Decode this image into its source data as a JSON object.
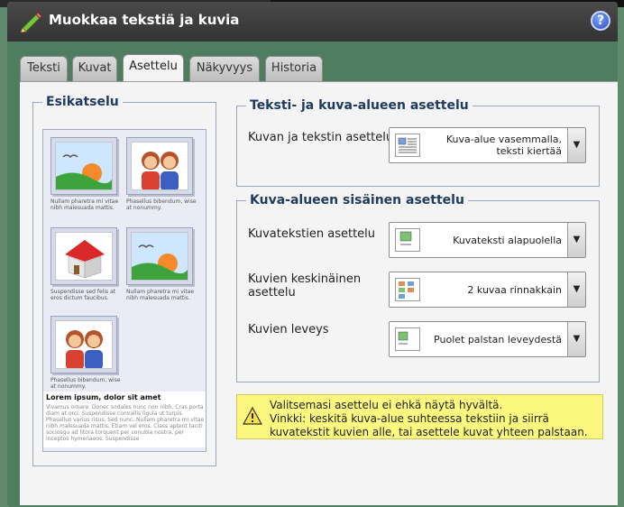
{
  "dialog": {
    "title": "Muokkaa tekstiä ja kuvia",
    "help_glyph": "?"
  },
  "tabs": [
    {
      "label": "Teksti"
    },
    {
      "label": "Kuvat"
    },
    {
      "label": "Asettelu"
    },
    {
      "label": "Näkyvyys"
    },
    {
      "label": "Historia"
    }
  ],
  "active_tab": "Asettelu",
  "preview": {
    "legend": "Esikatselu",
    "captions": [
      "Nullam pharetra mi vitae nibh malesuada mattis.",
      "Phasellus bibendum, wise at nonummy.",
      "Suspendisse sed felis at eros dictum faucibus.",
      "Nullam pharetra mi vitae nibh malesuada mattis.",
      "Phasellus bibendum, wise at nonummy."
    ],
    "lorem_title": "Lorem ipsum, dolor sit amet",
    "lorem_body": "Vivamus ornare. Donec sodales nunc non nibh. Cras porta diam at orci. Suspendisse convallis ligula ut turpis. Phasellus varius risus. Sed nunc. Nullam pharetra mi vitae nibh malesuada mattis. Etiam vel eros. Class aptent taciti sociosqu ad litora torquent per conubia nostra, per inceptos hymenaeos. Suspendisse"
  },
  "text_image_layout": {
    "legend": "Teksti- ja kuva-alueen asettelu",
    "label": "Kuvan ja tekstin asettelu",
    "value": "Kuva-alue vasemmalla, teksti kiertää"
  },
  "image_area_layout": {
    "legend": "Kuva-alueen sisäinen asettelu",
    "rows": [
      {
        "label": "Kuvatekstien asettelu",
        "value": "Kuvateksti alapuolella"
      },
      {
        "label": "Kuvien keskinäinen asettelu",
        "value": "2 kuvaa rinnakkain"
      },
      {
        "label": "Kuvien leveys",
        "value": "Puolet palstan leveydestä"
      }
    ]
  },
  "warning": {
    "line1": "Valitsemasi asettelu ei ehkä näytä hyvältä.",
    "line2": "Vinkki: keskitä kuva-alue suhteessa tekstiin ja siirrä",
    "line3": "kuvatekstit kuvien alle, tai asettele kuvat yhteen palstaan."
  },
  "colors": {
    "title_bar": "#3d3d3d",
    "dialog_frame": "#4f7d5f",
    "legend_text": "#1f3a5f",
    "warning_bg": "#fbf77f"
  }
}
